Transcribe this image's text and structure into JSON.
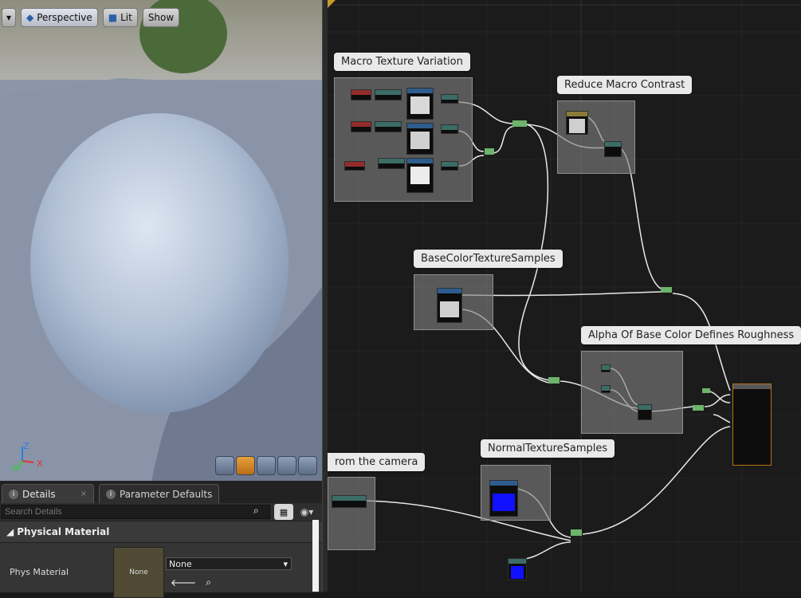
{
  "viewport": {
    "toolbar": {
      "perspective": "Perspective",
      "lit": "Lit",
      "show": "Show"
    },
    "axes": {
      "x": "X",
      "y": "Y",
      "z": "Z"
    }
  },
  "details": {
    "tabs": [
      {
        "label": "Details"
      },
      {
        "label": "Parameter Defaults"
      }
    ],
    "search_placeholder": "Search Details",
    "section": "Physical Material",
    "prop_label": "Phys Material",
    "thumbnail": "None",
    "combo_value": "None"
  },
  "graph": {
    "comments": [
      {
        "label": "Macro Texture Variation"
      },
      {
        "label": "Reduce Macro Contrast"
      },
      {
        "label": "BaseColorTextureSamples"
      },
      {
        "label": "Alpha Of Base Color Defines Roughness"
      },
      {
        "label": "rom the camera"
      },
      {
        "label": "NormalTextureSamples"
      }
    ]
  }
}
